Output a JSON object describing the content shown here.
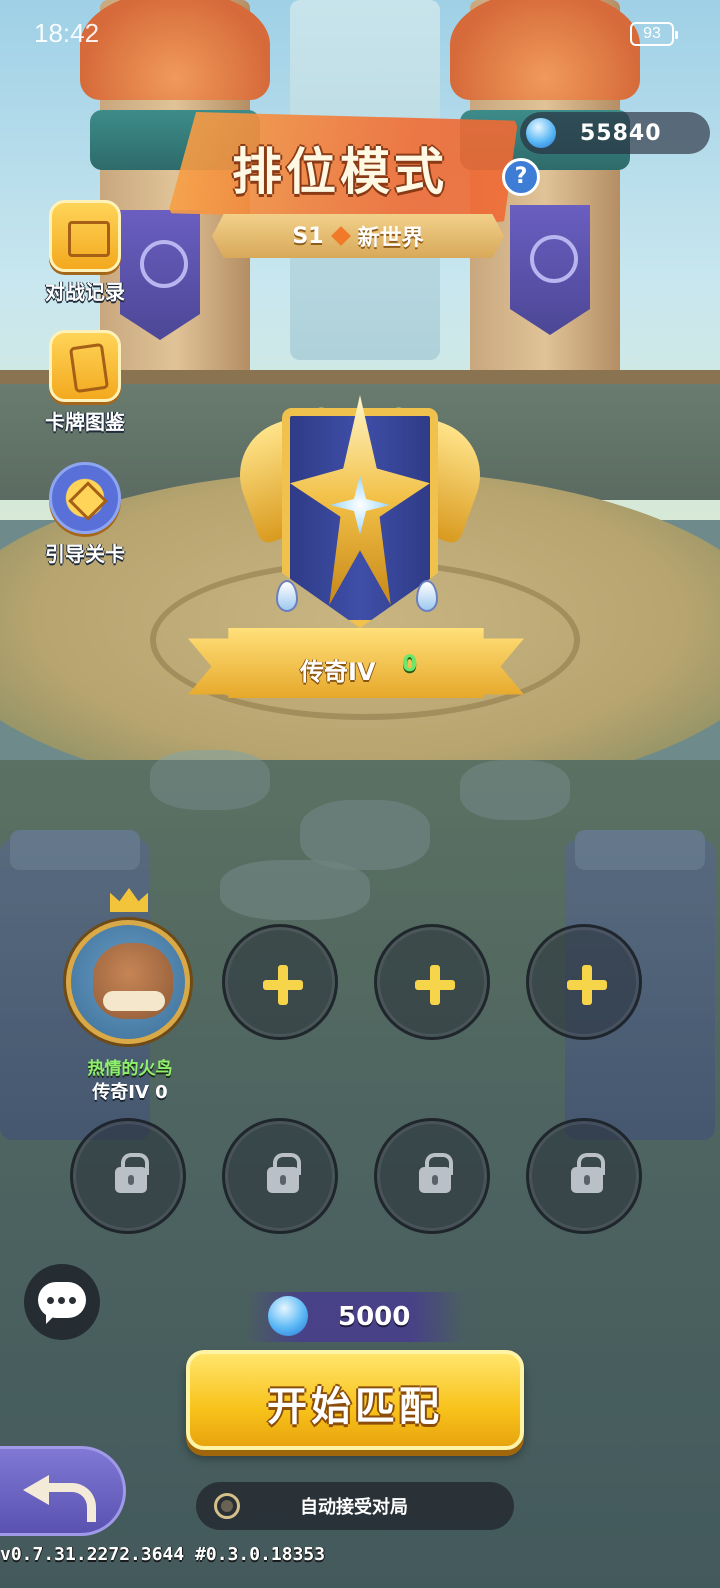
{
  "status_bar": {
    "time": "18:42",
    "battery": "93"
  },
  "currency": {
    "icon": "blue-gem-icon",
    "value": "55840"
  },
  "header": {
    "title": "排位模式",
    "help": "?",
    "season_code": "S1",
    "season_name": "新世界"
  },
  "side_menu": {
    "items": [
      {
        "label": "对战记录",
        "icon": "book-icon"
      },
      {
        "label": "卡牌图鉴",
        "icon": "cards-icon"
      },
      {
        "label": "引导关卡",
        "icon": "compass-icon"
      }
    ]
  },
  "rank": {
    "name": "传奇IV",
    "points": "0"
  },
  "team": {
    "player": {
      "name": "热情的火鸟",
      "rank": "传奇IV 0"
    }
  },
  "match": {
    "cost": "5000",
    "start_label": "开始匹配",
    "auto_accept_label": "自动接受对局"
  },
  "footer": {
    "version": "v0.7.31.2272.3644 #0.3.0.18353"
  },
  "colors": {
    "accent_yellow": "#f8c21b",
    "gem_blue": "#58b7f5",
    "season_orange": "#f06a34",
    "back_purple": "#5a52b0"
  }
}
